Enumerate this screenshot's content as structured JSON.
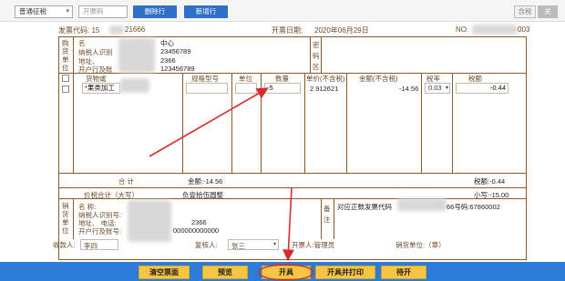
{
  "toolbar": {
    "invoice_type": "普通征税",
    "invoice_code_placeholder": "开票码",
    "delete_row": "删除行",
    "add_row": "新增行",
    "tax_included": "含税",
    "close": "关"
  },
  "header": {
    "invoice_code_label": "发票代码: 15",
    "invoice_code_tail": "21666",
    "date_label": "开票日期:",
    "date_value": "2020年06月29日",
    "no_label": "NO:",
    "no_tail": "003"
  },
  "buyer": {
    "side_label": "购货单位",
    "name_label": "名",
    "name_tail": "中心",
    "tax_id_label": "纳税人识别",
    "tax_id_tail": "23456789",
    "address_label": "地址、",
    "address_tail": "2366",
    "bank_label": "开户行及账",
    "bank_tail": "123456789",
    "pwd_label": "密码区"
  },
  "items": {
    "columns": [
      "货物或",
      "规格型号",
      "单位",
      "数量",
      "单价(不含税)",
      "金额(不含税)",
      "税率",
      "税额"
    ],
    "row": {
      "name": "*果类加工",
      "quantity": "-5",
      "unit_price": "2.912621",
      "amount": "-14.56",
      "tax_rate": "0.03",
      "tax": "-0.44"
    }
  },
  "totals": {
    "total_label": "合    计",
    "amount_total": "金额:-14.56",
    "tax_total": "税额:-0.44",
    "sum_label": "价税合计（大写）",
    "sum_words": "负壹拾伍圆整",
    "sum_small": "小写:-15.00"
  },
  "seller": {
    "side_label": "销货单位",
    "name_label": "名    称:",
    "tax_id_label": "纳税人识别号:",
    "address_label": "地址、    电话:",
    "address_tail": "2366",
    "bank_label": "开户行及账号:",
    "bank_tail": "000000000000",
    "remark_label": "备注",
    "remark_text": "对应正数发票代码",
    "remark_tail": "66号码:67860002"
  },
  "footer": {
    "payee_label": "收款人:",
    "payee_value": "李四",
    "reviewer_label": "复核人:",
    "reviewer_value": "张三",
    "issuer_label": "开票人:管理员",
    "seller_label": "销货单位:（章）"
  },
  "actions": {
    "clear": "清空票面",
    "preview": "预览",
    "issue": "开具",
    "issue_print": "开具并打印",
    "pending": "待开"
  },
  "colors": {
    "accent_blue": "#2c7bd6",
    "button_yellow": "#f6c544",
    "annotation_red": "#d92b2b",
    "frame_brown": "#8b5a2b"
  }
}
